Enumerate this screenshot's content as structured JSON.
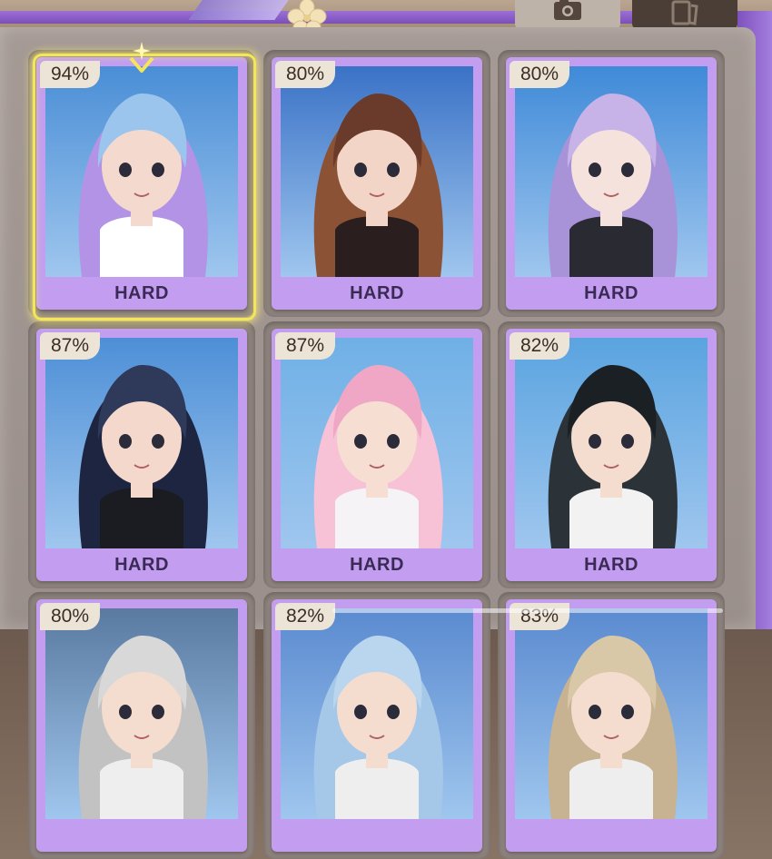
{
  "header": {
    "tabs": [
      {
        "icon": "camera-icon"
      },
      {
        "icon": "cards-icon"
      }
    ],
    "decor_icon": "flower-icon"
  },
  "cards": [
    {
      "percent": "94%",
      "difficulty": "HARD",
      "selected": true,
      "hair": "#9cc5ee",
      "hair2": "#b393e6",
      "bg": "#4a8ed6",
      "skin": "#f4d9cf",
      "outfit": "#ffffff"
    },
    {
      "percent": "80%",
      "difficulty": "HARD",
      "selected": false,
      "hair": "#6a3b2a",
      "hair2": "#8b5236",
      "bg": "#3a72c6",
      "skin": "#f2d5c6",
      "outfit": "#2a1e1e"
    },
    {
      "percent": "80%",
      "difficulty": "HARD",
      "selected": false,
      "hair": "#c7b3e8",
      "hair2": "#a993d8",
      "bg": "#3f8ad8",
      "skin": "#f6e2dc",
      "outfit": "#2a2a33"
    },
    {
      "percent": "87%",
      "difficulty": "HARD",
      "selected": false,
      "hair": "#2f3a5a",
      "hair2": "#1e2540",
      "bg": "#4d8fd6",
      "skin": "#f4d8cc",
      "outfit": "#1b1b22"
    },
    {
      "percent": "87%",
      "difficulty": "HARD",
      "selected": false,
      "hair": "#f0a7c6",
      "hair2": "#f7c1d6",
      "bg": "#6fb0e6",
      "skin": "#f6ded3",
      "outfit": "#f5f3f6"
    },
    {
      "percent": "82%",
      "difficulty": "HARD",
      "selected": false,
      "hair": "#1b2024",
      "hair2": "#2b3338",
      "bg": "#5aa4e0",
      "skin": "#f4dccf",
      "outfit": "#f2f2f2"
    },
    {
      "percent": "80%",
      "difficulty": "",
      "selected": false,
      "hair": "#d8d8d8",
      "hair2": "#c2c2c2",
      "bg": "#5a7aa0",
      "skin": "#f4dccf",
      "outfit": "#eeeeee"
    },
    {
      "percent": "82%",
      "difficulty": "",
      "selected": false,
      "hair": "#b9d6ee",
      "hair2": "#a5c7e8",
      "bg": "#5a8ad0",
      "skin": "#f4dccf",
      "outfit": "#eeeeee"
    },
    {
      "percent": "83%",
      "difficulty": "",
      "selected": false,
      "hair": "#d9c8a8",
      "hair2": "#c7b291",
      "bg": "#5a8ad0",
      "skin": "#f4dccf",
      "outfit": "#eeeeee"
    }
  ],
  "colors": {
    "card_bg": "#c39ef0",
    "badge_bg": "#ece4d6",
    "selection": "#f4e65a",
    "frame_purple": "#8d5fcf"
  }
}
